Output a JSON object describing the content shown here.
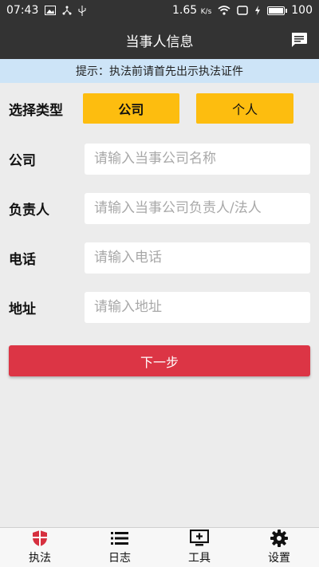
{
  "status_bar": {
    "time": "07:43",
    "speed": "1.65",
    "speed_unit": "K/s",
    "battery": "100"
  },
  "header": {
    "title": "当事人信息",
    "message_icon": "message-icon"
  },
  "notice": "提示：执法前请首先出示执法证件",
  "form": {
    "type_label": "选择类型",
    "type_options": [
      "公司",
      "个人"
    ],
    "selected_type": "公司",
    "company_label": "公司",
    "company_placeholder": "请输入当事公司名称",
    "person_label": "负责人",
    "person_placeholder": "请输入当事公司负责人/法人",
    "phone_label": "电话",
    "phone_placeholder": "请输入电话",
    "address_label": "地址",
    "address_placeholder": "请输入地址",
    "next_label": "下一步"
  },
  "bottom_nav": [
    {
      "label": "执法",
      "icon": "shield-icon",
      "active": true
    },
    {
      "label": "日志",
      "icon": "list-icon",
      "active": false
    },
    {
      "label": "工具",
      "icon": "toolbox-icon",
      "active": false
    },
    {
      "label": "设置",
      "icon": "gear-icon",
      "active": false
    }
  ],
  "colors": {
    "bar_bg": "#333333",
    "notice_bg": "#cde4f7",
    "type_button": "#fdbd0f",
    "next_button": "#dc3545",
    "active_nav": "#d6303f"
  }
}
